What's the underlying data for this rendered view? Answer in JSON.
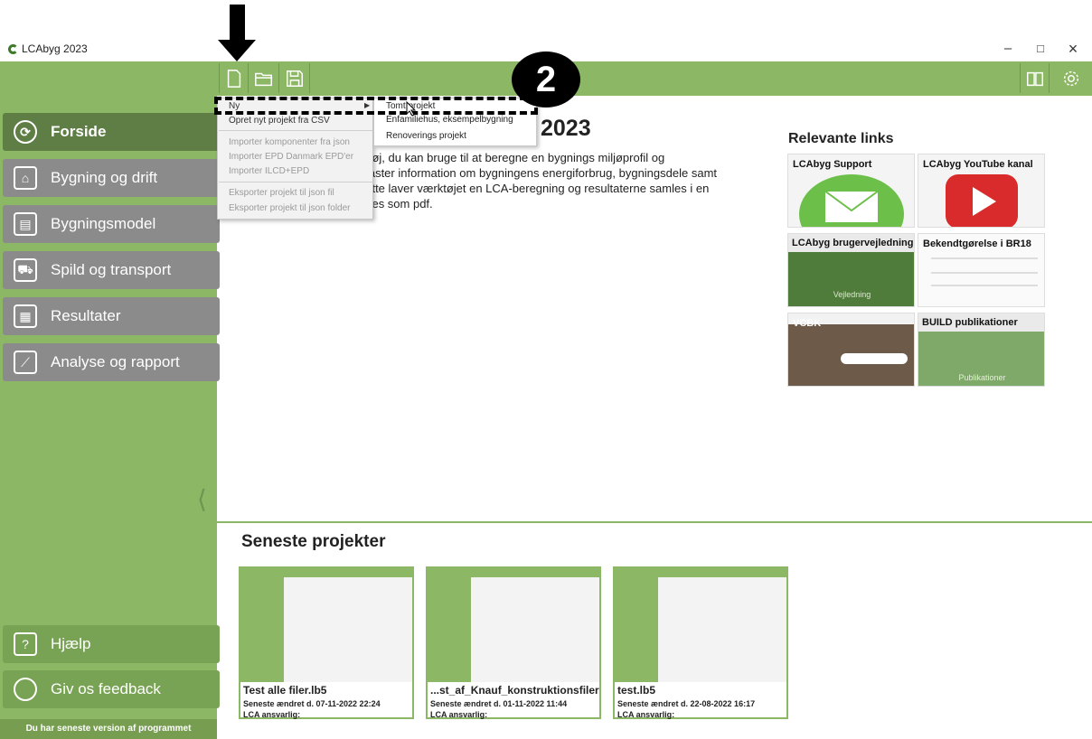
{
  "window": {
    "title": "LCAbyg 2023",
    "controls": {
      "minimize": "–",
      "maximize": "□",
      "close": "×"
    }
  },
  "toolbar": {
    "left_icons": [
      "new-file-icon",
      "open-folder-icon",
      "save-icon"
    ],
    "right_icons": [
      "book-icon",
      "gear-icon"
    ]
  },
  "sidebar": {
    "items": [
      {
        "label": "Forside",
        "icon": "home-leaf-icon",
        "active": true
      },
      {
        "label": "Bygning og drift",
        "icon": "house-icon"
      },
      {
        "label": "Bygningsmodel",
        "icon": "document-icon"
      },
      {
        "label": "Spild og transport",
        "icon": "truck-icon"
      },
      {
        "label": "Resultater",
        "icon": "table-icon"
      },
      {
        "label": "Analyse og rapport",
        "icon": "chart-icon"
      }
    ],
    "help": {
      "label": "Hjælp",
      "icon_text": "?"
    },
    "feedback": {
      "label": "Giv os feedback"
    },
    "collapse_glyph": "⟨",
    "version_note": "Du har seneste version af programmet"
  },
  "main": {
    "title": "2023",
    "intro_lines": [
      "rktøj, du kan bruge til at beregne en bygnings miljøprofil og",
      "dtaster information om bygningens energiforbrug, bygningsdele samt",
      "dette laver værktøjet en LCA-beregning og resultaterne samles i en",
      "ades som pdf."
    ]
  },
  "links": {
    "title": "Relevante links",
    "tiles": [
      {
        "label": "LCAbyg Support"
      },
      {
        "label": "LCAbyg YouTube kanal"
      },
      {
        "label": "LCAbyg brugervejledning",
        "caption": "Vejledning"
      },
      {
        "label": "Bekendtgørelse i BR18"
      },
      {
        "label": "VCBK"
      },
      {
        "label": "BUILD publikationer",
        "caption": "Publikationer"
      }
    ]
  },
  "recent": {
    "title": "Seneste projekter",
    "projects": [
      {
        "name": "Test alle filer.lb5",
        "modified": "Seneste ændret d. 07-11-2022 22:24",
        "responsible": "LCA ansvarlig:"
      },
      {
        "name": "...st_af_Knauf_konstruktionsfiler",
        "modified": "Seneste ændret d. 01-11-2022 11:44",
        "responsible": "LCA ansvarlig:"
      },
      {
        "name": "test.lb5",
        "modified": "Seneste ændret d. 22-08-2022 16:17",
        "responsible": "LCA ansvarlig:"
      }
    ]
  },
  "file_menu": {
    "items": [
      {
        "label": "Ny",
        "enabled": true,
        "submenu_arrow": "▶"
      },
      {
        "label": "Opret nyt projekt fra CSV",
        "enabled": true
      },
      {
        "label": "Importer komponenter fra json",
        "enabled": false
      },
      {
        "label": "Importer EPD Danmark EPD'er",
        "enabled": false
      },
      {
        "label": "Importer ILCD+EPD",
        "enabled": false
      },
      {
        "label": "Eksporter projekt til json fil",
        "enabled": false
      },
      {
        "label": "Eksporter projekt til json folder",
        "enabled": false
      }
    ]
  },
  "new_submenu": {
    "items": [
      {
        "label": "Tomt projekt"
      },
      {
        "label": "Enfamiliehus, eksempelbygning"
      },
      {
        "label": "Renoverings projekt"
      }
    ]
  },
  "annotation": {
    "step_number": "2"
  },
  "colors": {
    "toolbar_green": "#8cb865",
    "active_nav": "#5f7e45",
    "inactive_nav": "#8b8b8b"
  }
}
